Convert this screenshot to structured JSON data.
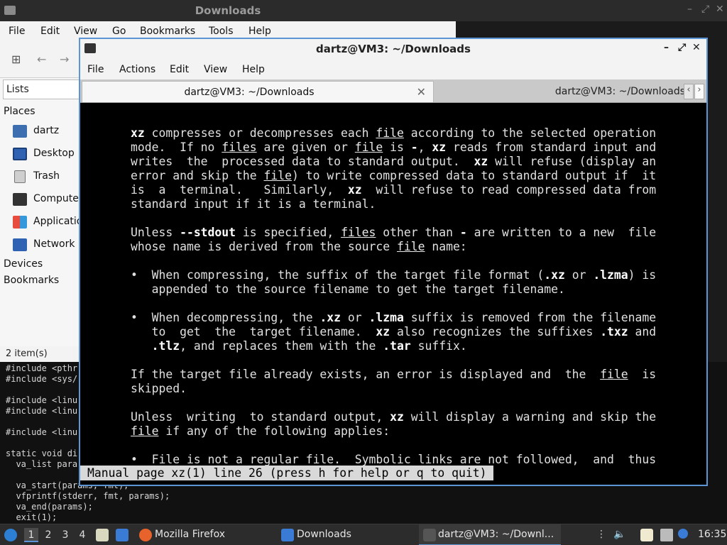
{
  "file_manager": {
    "title": "Downloads",
    "menu": [
      "File",
      "Edit",
      "View",
      "Go",
      "Bookmarks",
      "Tools",
      "Help"
    ],
    "lists_label": "Lists",
    "places_heading": "Places",
    "places": [
      "dartz",
      "Desktop",
      "Trash",
      "Computer",
      "Applications",
      "Network"
    ],
    "devices_heading": "Devices",
    "bookmarks_heading": "Bookmarks",
    "status": "2 item(s)"
  },
  "code_lines": [
    "#include <pthr",
    "#include <sys/",
    "",
    "#include <linu",
    "#include <linu",
    "",
    "#include <linu",
    "",
    "static void di",
    "  va_list para",
    "",
    "  va_start(params, fmt);",
    "  vfprintf(stderr, fmt, params);",
    "  va_end(params);",
    "  exit(1);"
  ],
  "terminal": {
    "title": "dartz@VM3: ~/Downloads",
    "menu": [
      "File",
      "Actions",
      "Edit",
      "View",
      "Help"
    ],
    "tabs": [
      "dartz@VM3: ~/Downloads",
      "dartz@VM3: ~/Downloads"
    ],
    "status_line": "Manual page xz(1) line 26 (press h for help or q to quit)"
  },
  "taskbar": {
    "workspaces": [
      "1",
      "2",
      "3",
      "4"
    ],
    "active_workspace": "1",
    "tasks": [
      "Mozilla Firefox",
      "Downloads",
      "dartz@VM3: ~/Downl..."
    ],
    "clock": "16:35"
  },
  "colors": {
    "accent": "#5b95d6",
    "terminal_bg": "#000000",
    "terminal_fg": "#e0e0e0",
    "taskbar_bg": "#2c2c2c"
  }
}
